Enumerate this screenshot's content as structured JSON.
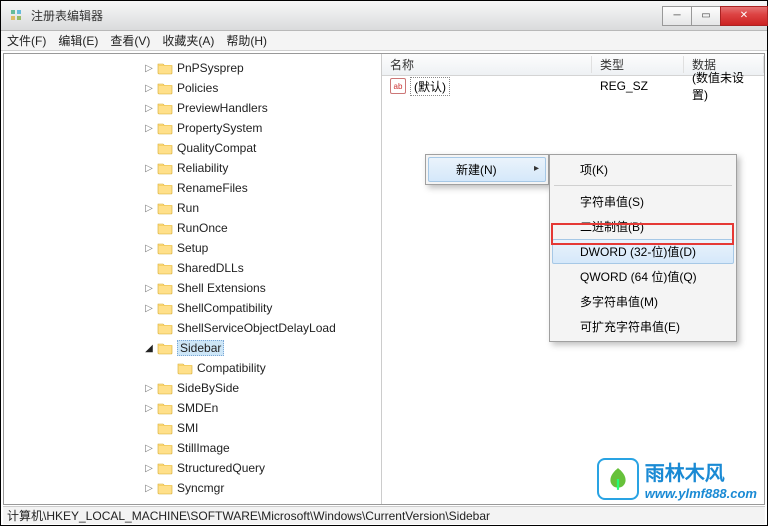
{
  "window": {
    "title": "注册表编辑器"
  },
  "menubar": [
    "文件(F)",
    "编辑(E)",
    "查看(V)",
    "收藏夹(A)",
    "帮助(H)"
  ],
  "tree": [
    {
      "indent": 135,
      "toggle": "closed",
      "label": "PnPSysprep"
    },
    {
      "indent": 135,
      "toggle": "closed",
      "label": "Policies"
    },
    {
      "indent": 135,
      "toggle": "closed",
      "label": "PreviewHandlers"
    },
    {
      "indent": 135,
      "toggle": "closed",
      "label": "PropertySystem"
    },
    {
      "indent": 135,
      "toggle": "none",
      "label": "QualityCompat"
    },
    {
      "indent": 135,
      "toggle": "closed",
      "label": "Reliability"
    },
    {
      "indent": 135,
      "toggle": "none",
      "label": "RenameFiles"
    },
    {
      "indent": 135,
      "toggle": "closed",
      "label": "Run"
    },
    {
      "indent": 135,
      "toggle": "none",
      "label": "RunOnce"
    },
    {
      "indent": 135,
      "toggle": "closed",
      "label": "Setup"
    },
    {
      "indent": 135,
      "toggle": "none",
      "label": "SharedDLLs"
    },
    {
      "indent": 135,
      "toggle": "closed",
      "label": "Shell Extensions"
    },
    {
      "indent": 135,
      "toggle": "closed",
      "label": "ShellCompatibility"
    },
    {
      "indent": 135,
      "toggle": "none",
      "label": "ShellServiceObjectDelayLoad"
    },
    {
      "indent": 135,
      "toggle": "expanded",
      "label": "Sidebar",
      "selected": true
    },
    {
      "indent": 155,
      "toggle": "none",
      "label": "Compatibility"
    },
    {
      "indent": 135,
      "toggle": "closed",
      "label": "SideBySide"
    },
    {
      "indent": 135,
      "toggle": "closed",
      "label": "SMDEn"
    },
    {
      "indent": 135,
      "toggle": "none",
      "label": "SMI"
    },
    {
      "indent": 135,
      "toggle": "closed",
      "label": "StillImage"
    },
    {
      "indent": 135,
      "toggle": "closed",
      "label": "StructuredQuery"
    },
    {
      "indent": 135,
      "toggle": "closed",
      "label": "Syncmgr"
    }
  ],
  "list": {
    "headers": {
      "name": "名称",
      "type": "类型",
      "data": "数据"
    },
    "rows": [
      {
        "icon": "ab",
        "name": "(默认)",
        "type": "REG_SZ",
        "data": "(数值未设置)"
      }
    ]
  },
  "context_menu": {
    "parent": {
      "label": "新建(N)"
    },
    "sub": [
      {
        "label": "项(K)"
      },
      {
        "sep": true
      },
      {
        "label": "字符串值(S)"
      },
      {
        "label": "二进制值(B)"
      },
      {
        "label": "DWORD (32-位)值(D)",
        "highlight": true,
        "redbox": true
      },
      {
        "label": "QWORD (64 位)值(Q)"
      },
      {
        "label": "多字符串值(M)"
      },
      {
        "label": "可扩充字符串值(E)"
      }
    ]
  },
  "statusbar": "计算机\\HKEY_LOCAL_MACHINE\\SOFTWARE\\Microsoft\\Windows\\CurrentVersion\\Sidebar",
  "watermark": {
    "brand": "雨林木风",
    "url": "www.ylmf888.com"
  }
}
